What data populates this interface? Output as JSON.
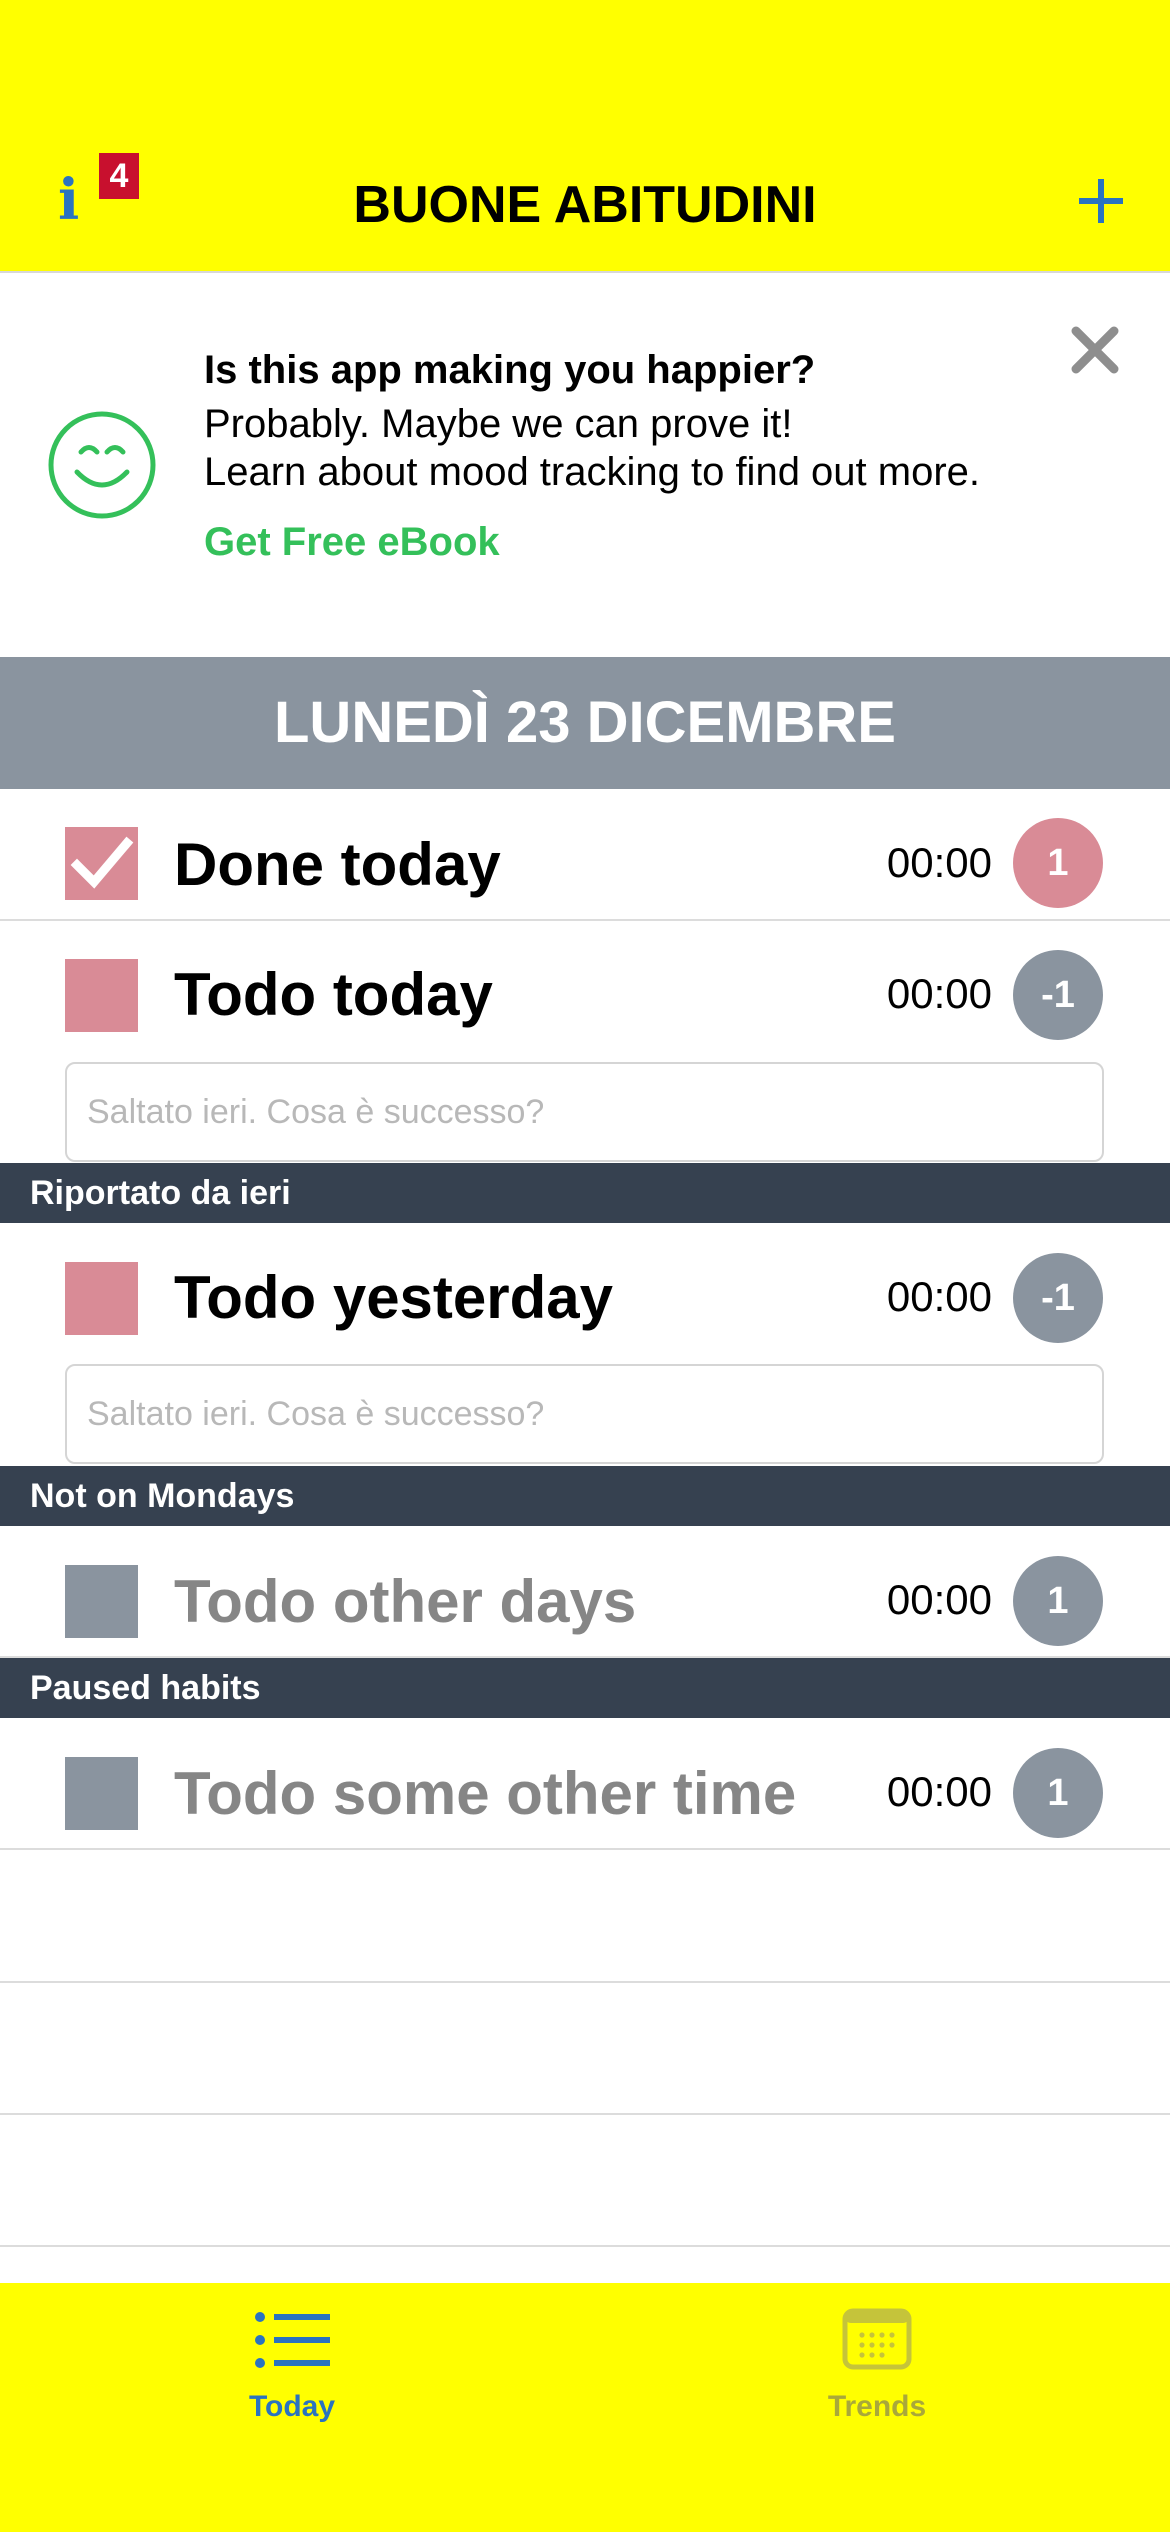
{
  "header": {
    "title": "BUONE ABITUDINI",
    "info_icon_glyph": "i",
    "info_badge": "4",
    "add_icon": "plus-icon",
    "accent_color": "#2a73c0",
    "background_color": "#ffff00"
  },
  "promo": {
    "title": "Is this app making you happier?",
    "line1": "Probably. Maybe we can prove it!",
    "line2": "Learn about mood tracking to find out more.",
    "link": "Get Free eBook",
    "icon": "smiley-icon",
    "close_icon": "close-icon"
  },
  "date_bar": {
    "label": "LUNEDÌ 23 DICEMBRE"
  },
  "habits": [
    {
      "label": "Done today",
      "time": "00:00",
      "count": "1",
      "checked": true
    },
    {
      "label": "Todo today",
      "time": "00:00",
      "count": "-1",
      "checked": false,
      "note_placeholder": "Saltato ieri. Cosa è successo?"
    }
  ],
  "sections": [
    {
      "title": "Riportato da ieri",
      "habits": [
        {
          "label": "Todo yesterday",
          "time": "00:00",
          "count": "-1",
          "checked": false,
          "note_placeholder": "Saltato ieri. Cosa è successo?"
        }
      ]
    },
    {
      "title": "Not on Mondays",
      "habits": [
        {
          "label": "Todo other days",
          "time": "00:00",
          "count": "1",
          "checked": false
        }
      ]
    },
    {
      "title": "Paused habits",
      "habits": [
        {
          "label": "Todo some other time",
          "time": "00:00",
          "count": "1",
          "checked": false
        }
      ]
    }
  ],
  "tabbar": {
    "tabs": [
      {
        "label": "Today",
        "icon": "list-icon",
        "active": true
      },
      {
        "label": "Trends",
        "icon": "calendar-icon",
        "active": false
      }
    ]
  }
}
